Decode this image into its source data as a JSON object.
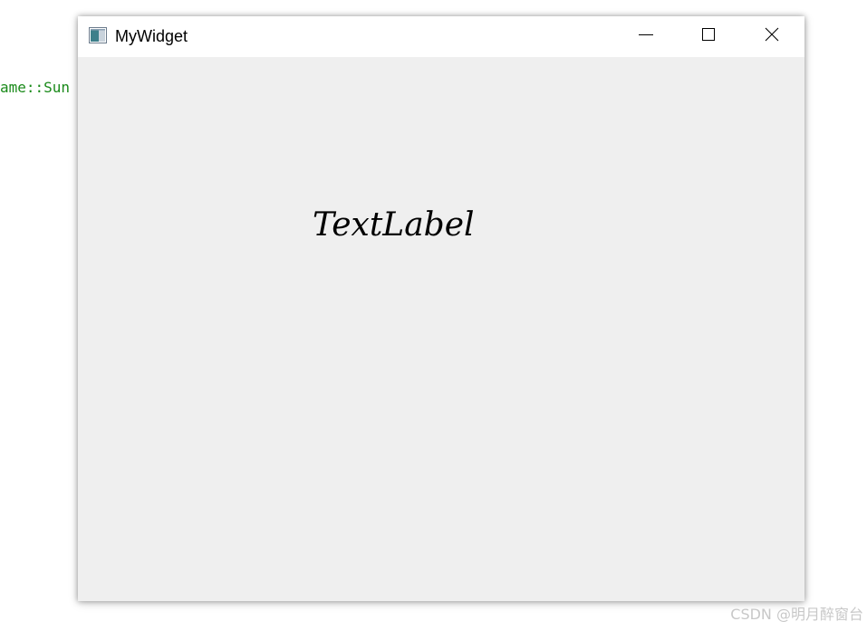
{
  "background": {
    "code_fragment": "ame::Sun"
  },
  "window": {
    "title": "MyWidget",
    "icon": "qt-app-icon",
    "controls": {
      "minimize": "minimize-icon",
      "maximize": "maximize-icon",
      "close": "close-icon"
    }
  },
  "content": {
    "label_text": "TextLabel"
  },
  "watermark": {
    "text": "CSDN @明月醉窗台"
  },
  "colors": {
    "client_background": "#efefef",
    "titlebar_background": "#ffffff",
    "code_text": "#1a8a1a",
    "watermark_text": "#c8c8c8"
  }
}
